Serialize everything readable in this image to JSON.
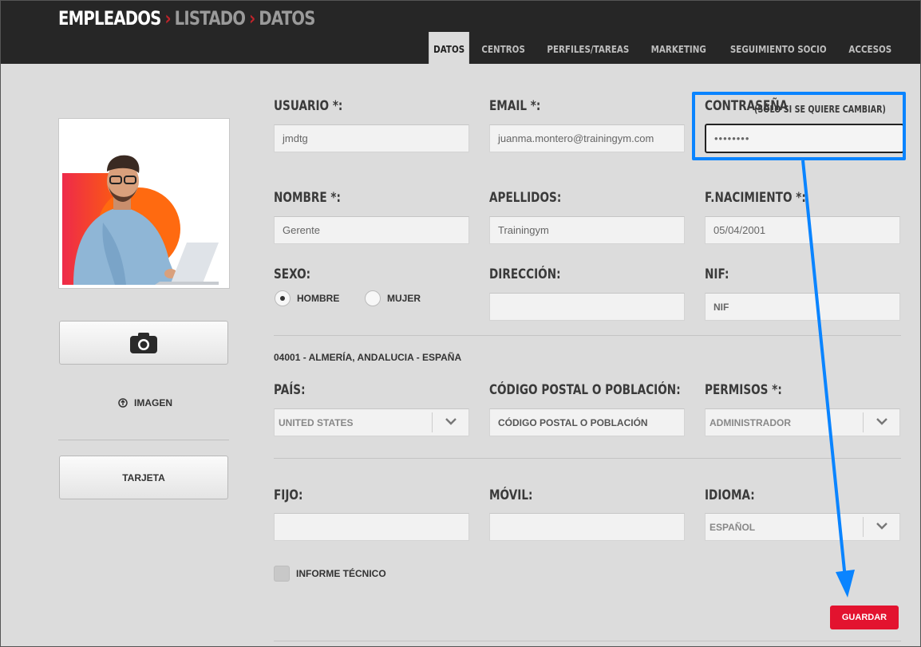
{
  "breadcrumb": {
    "item1": "EMPLEADOS",
    "item2": "LISTADO",
    "item3": "DATOS"
  },
  "tabs": [
    {
      "label": "DATOS",
      "active": true
    },
    {
      "label": "CENTROS"
    },
    {
      "label": "PERFILES/TAREAS"
    },
    {
      "label": "MARKETING"
    },
    {
      "label": "SEGUIMIENTO SOCIO"
    },
    {
      "label": "ACCESOS"
    }
  ],
  "sidebar": {
    "image_label": "IMAGEN",
    "card_button": "TARJETA"
  },
  "form": {
    "usuario": {
      "label": "USUARIO *:",
      "value": "jmdtg"
    },
    "email": {
      "label": "EMAIL *:",
      "value": "juanma.montero@trainingym.com"
    },
    "password": {
      "label": "CONTRASEÑA",
      "hint": "(SÓLO SI SE QUIERE CAMBIAR)",
      "value": "••••••••"
    },
    "nombre": {
      "label": "NOMBRE *:",
      "value": "Gerente"
    },
    "apellidos": {
      "label": "APELLIDOS:",
      "value": "Trainingym"
    },
    "nacimiento": {
      "label": "F.NACIMIENTO *:",
      "value": "05/04/2001"
    },
    "sexo": {
      "label": "SEXO:",
      "option1": "HOMBRE",
      "option2": "MUJER",
      "selected": "HOMBRE"
    },
    "direccion": {
      "label": "DIRECCIÓN:",
      "value": ""
    },
    "nif": {
      "label": "NIF:",
      "value": "NIF"
    },
    "address_summary": "04001 - ALMERÍA, ANDALUCIA - ESPAÑA",
    "pais": {
      "label": "PAÍS:",
      "value": "UNITED STATES"
    },
    "cp": {
      "label": "CÓDIGO POSTAL O POBLACIÓN:",
      "value": "CÓDIGO POSTAL O POBLACIÓN"
    },
    "permisos": {
      "label": "PERMISOS *:",
      "value": "ADMINISTRADOR"
    },
    "fijo": {
      "label": "FIJO:",
      "value": ""
    },
    "movil": {
      "label": "MÓVIL:",
      "value": ""
    },
    "idioma": {
      "label": "IDIOMA:",
      "value": "ESPAÑOL"
    },
    "informe": {
      "label": "INFORME TÉCNICO",
      "checked": false
    }
  },
  "actions": {
    "save": "GUARDAR"
  },
  "colors": {
    "topbar": "#262626",
    "accent_red": "#e3132f",
    "annotation_blue": "#0a84ff"
  }
}
